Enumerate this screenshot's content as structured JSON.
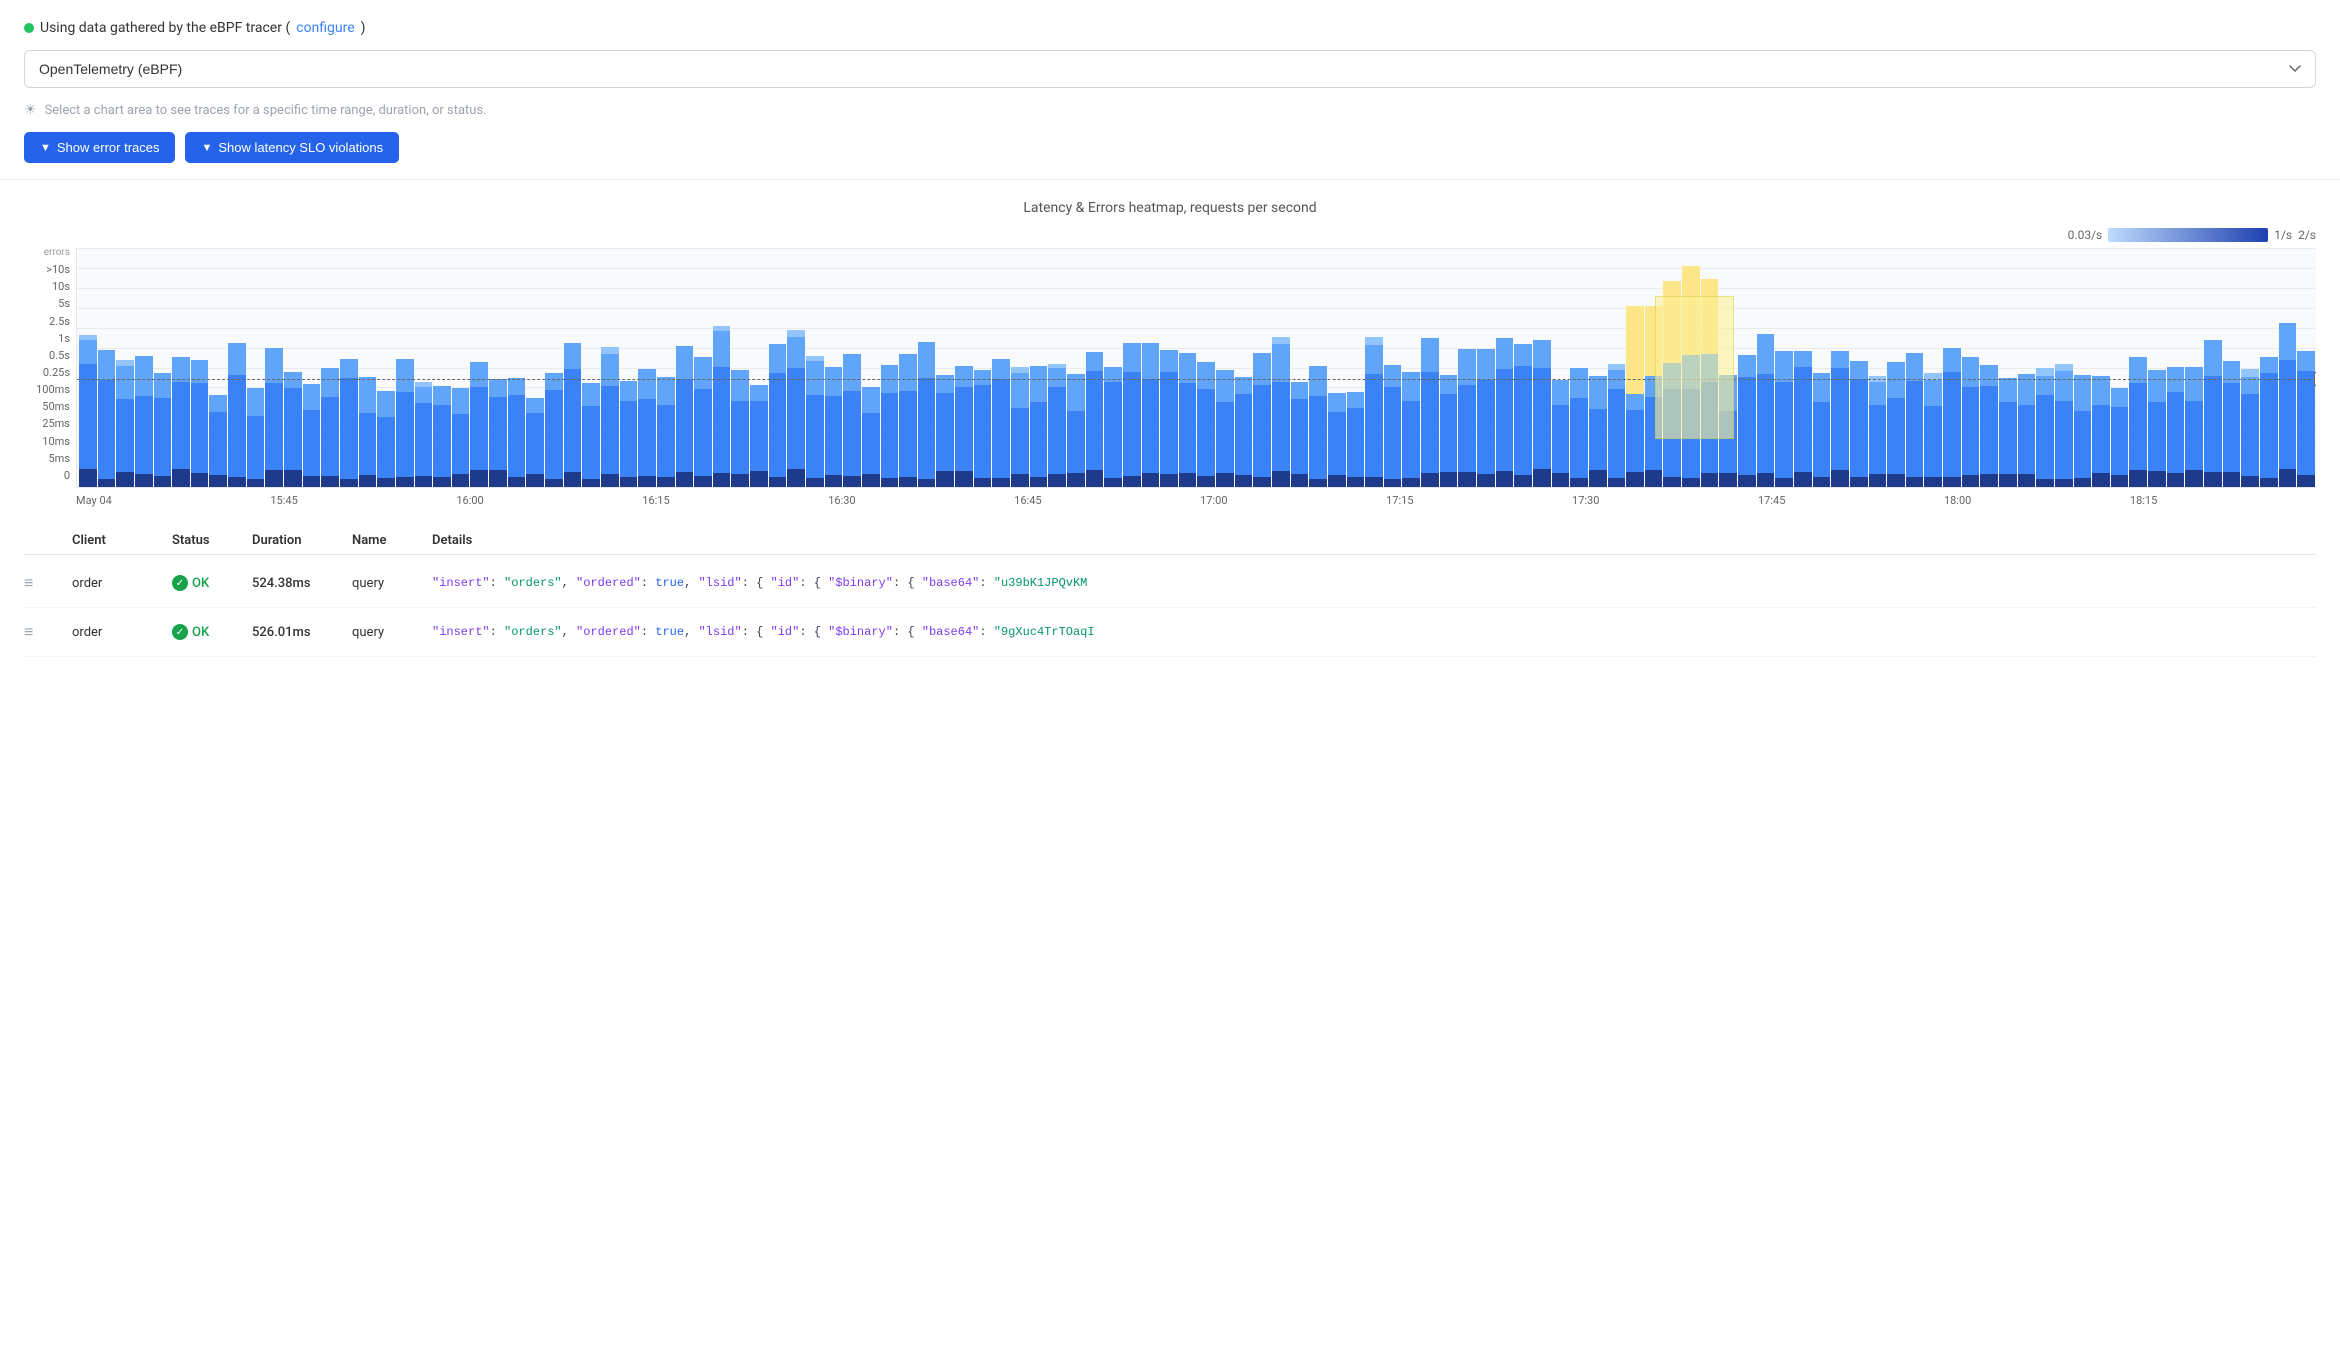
{
  "header": {
    "status_dot_color": "#22c55e",
    "status_text": "Using data gathered by the eBPF tracer (",
    "configure_link": "configure",
    "status_text_end": ")",
    "dropdown_value": "OpenTelemetry (eBPF)",
    "dropdown_options": [
      "OpenTelemetry (eBPF)",
      "OpenTelemetry",
      "eBPF"
    ],
    "hint_text": "Select a chart area to see traces for a specific time range, duration, or status.",
    "btn_error_traces": "Show error traces",
    "btn_slo_violations": "Show latency SLO violations"
  },
  "chart": {
    "title": "Latency & Errors heatmap, requests per second",
    "legend_min": "0.03/s",
    "legend_mid": "1/s",
    "legend_max": "2/s",
    "y_labels": [
      ">10s",
      "10s",
      "5s",
      "2.5s",
      "1s",
      "0.5s",
      "0.25s",
      "100ms",
      "50ms",
      "25ms",
      "10ms",
      "5ms",
      "0"
    ],
    "y_label_errors": "errors",
    "slo_label": "0.5s",
    "x_labels": [
      "May 04",
      "15:45",
      "16:00",
      "16:15",
      "16:30",
      "16:45",
      "17:00",
      "17:15",
      "17:30",
      "17:45",
      "18:00",
      "18:15",
      ""
    ]
  },
  "table": {
    "headers": [
      "",
      "Client",
      "Status",
      "Duration",
      "Name",
      "Details"
    ],
    "rows": [
      {
        "icon": "≡",
        "client": "order",
        "status": "OK",
        "duration": "524.38ms",
        "name": "query",
        "details": "{ \"insert\": \"orders\", \"ordered\": true, \"lsid\": { \"id\": { \"$binary\": { \"base64\": \"u39bK1JPQvKM"
      },
      {
        "icon": "≡",
        "client": "order",
        "status": "OK",
        "duration": "526.01ms",
        "name": "query",
        "details": "{ \"insert\": \"orders\", \"ordered\": true, \"lsid\": { \"id\": { \"$binary\": { \"base64\": \"9gXuc4TrTOaqI"
      }
    ]
  }
}
